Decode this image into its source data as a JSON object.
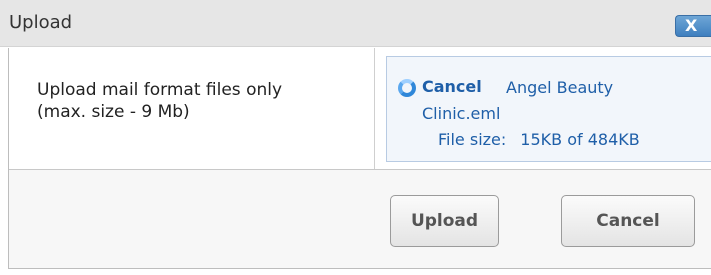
{
  "dialog": {
    "title": "Upload",
    "close_icon": "close-icon",
    "close_glyph": "X",
    "accent_color": "#3f7fbf"
  },
  "instructions": {
    "line1": "Upload mail format files only",
    "line2": "(max. size - 9 Mb)"
  },
  "progress": {
    "spinner_icon": "loading-spinner-icon",
    "cancel_label": "Cancel",
    "file_name_line1": "Angel Beauty",
    "file_name_line2": "Clinic.eml",
    "file_size_label": "File size:",
    "file_size_value": "15KB of 484KB",
    "uploaded_fraction": 0.031,
    "link_color": "#1f5fa8"
  },
  "buttons": {
    "upload_label": "Upload",
    "cancel_label": "Cancel"
  }
}
